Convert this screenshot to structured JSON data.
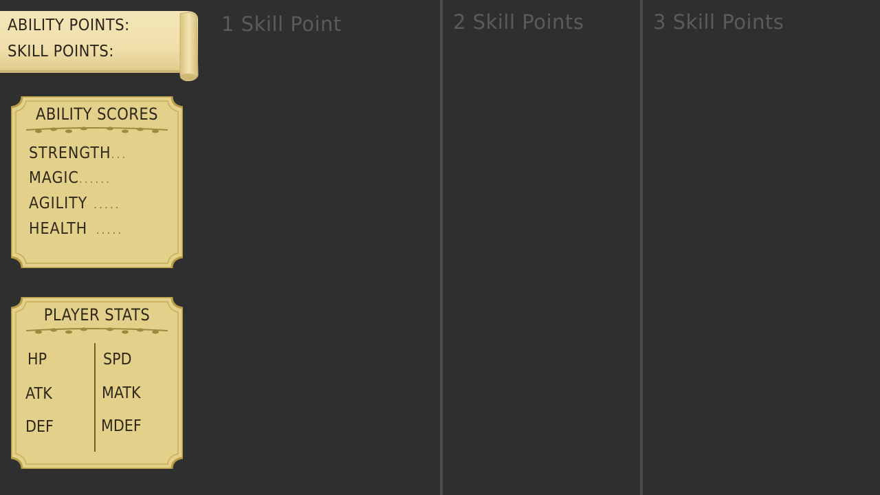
{
  "resources": {
    "ability_points_label": "ABILITY POINTS:",
    "skill_points_label": "SKILL POINTS:"
  },
  "ability_scores": {
    "title": "ABILITY SCORES",
    "rows": [
      {
        "label": "STRENGTH",
        "dots": "..."
      },
      {
        "label": "MAGIC",
        "dots": "......"
      },
      {
        "label": "AGILITY",
        "dots": "....."
      },
      {
        "label": "HEALTH",
        "dots": "....."
      }
    ]
  },
  "player_stats": {
    "title": "PLAYER STATS",
    "left": [
      "HP",
      "ATK",
      "DEF"
    ],
    "right": [
      "SPD",
      "MATK",
      "MDEF"
    ]
  },
  "skill_columns": [
    {
      "label": "1 Skill Point"
    },
    {
      "label": "2 Skill Points"
    },
    {
      "label": "3 Skill Points"
    }
  ],
  "colors": {
    "background": "#2f2f2f",
    "parchment": "#e2cf86",
    "parchment_border": "#bfa54e",
    "column_divider": "#4a4a4a",
    "column_header": "#5b5b5b"
  }
}
